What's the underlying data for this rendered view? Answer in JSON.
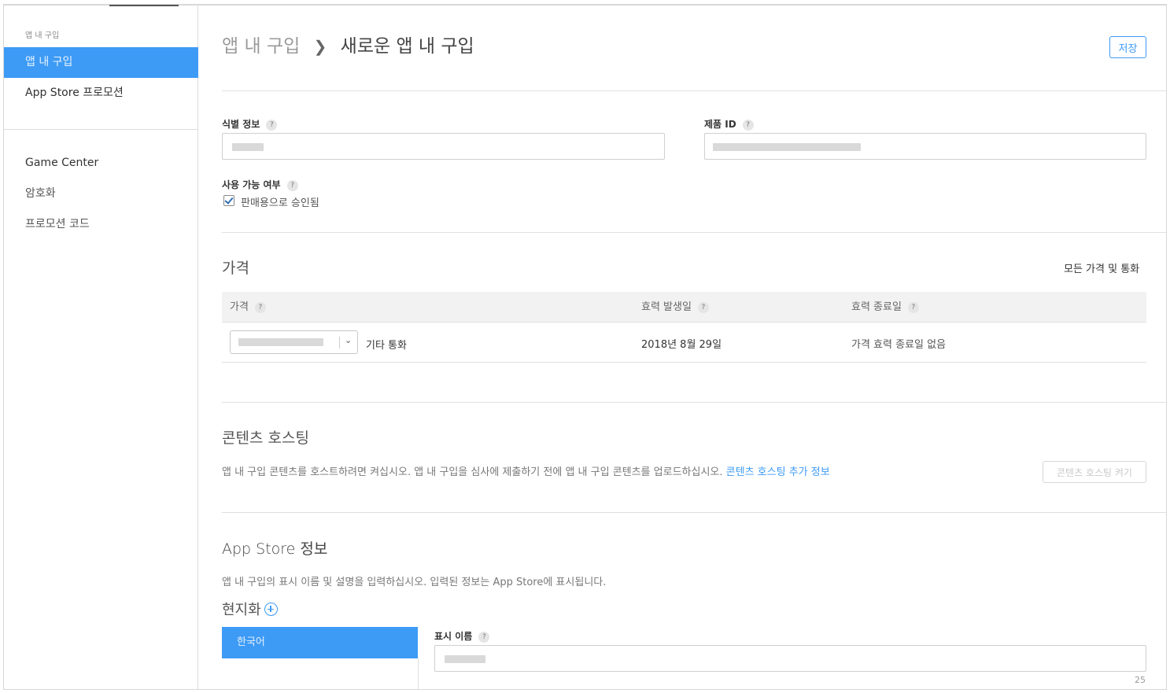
{
  "sidebar": {
    "group_label": "앱 내 구입",
    "items": [
      {
        "label": "앱 내 구입"
      },
      {
        "label": "App Store 프로모션"
      },
      {
        "label": "Game Center"
      },
      {
        "label": "암호화"
      },
      {
        "label": "프로모션 코드"
      }
    ]
  },
  "header": {
    "breadcrumb_root": "앱 내 구입",
    "breadcrumb_current": "새로운 앱 내 구입",
    "save_label": "저장"
  },
  "identity": {
    "reference_name_label": "식별 정보",
    "product_id_label": "제품 ID",
    "availability_label": "사용 가능 여부",
    "availability_checkbox_label": "판매용으로 승인됨",
    "availability_checked": true,
    "help_glyph": "?"
  },
  "pricing": {
    "title": "가격",
    "all_prices_link": "모든 가격 및 통화",
    "columns": [
      "가격",
      "효력 발생일",
      "효력 종료일"
    ],
    "other_currencies_link": "기타 통화",
    "start_date": "2018년 8월 29일",
    "end_date": "가격 효력 종료일 없음"
  },
  "hosting": {
    "title": "콘텐츠 호스팅",
    "description": "앱 내 구입 콘텐츠를 호스트하려면 켜십시오. 앱 내 구입을 심사에 제출하기 전에 앱 내 구입 콘텐츠를 업로드하십시오.",
    "more_info_link": "콘텐츠 호스팅 추가 정보",
    "toggle_button": "콘텐츠 호스팅 켜기"
  },
  "store_info": {
    "title": "App Store 정보",
    "description": "앱 내 구입의 표시 이름 및 설명을 입력하십시오. 입력된 정보는 App Store에 표시됩니다.",
    "localization_label": "현지화",
    "locale_tab": "한국어",
    "display_name_label": "표시 이름",
    "display_name_remaining": "25"
  },
  "colors": {
    "accent": "#3d9bf5",
    "sidebar_active_text": "#e4f1ff"
  },
  "icons": [
    "question-help-icon",
    "chevron-right-icon",
    "chevron-down-icon",
    "add-circle-icon",
    "checkmark-icon"
  ]
}
